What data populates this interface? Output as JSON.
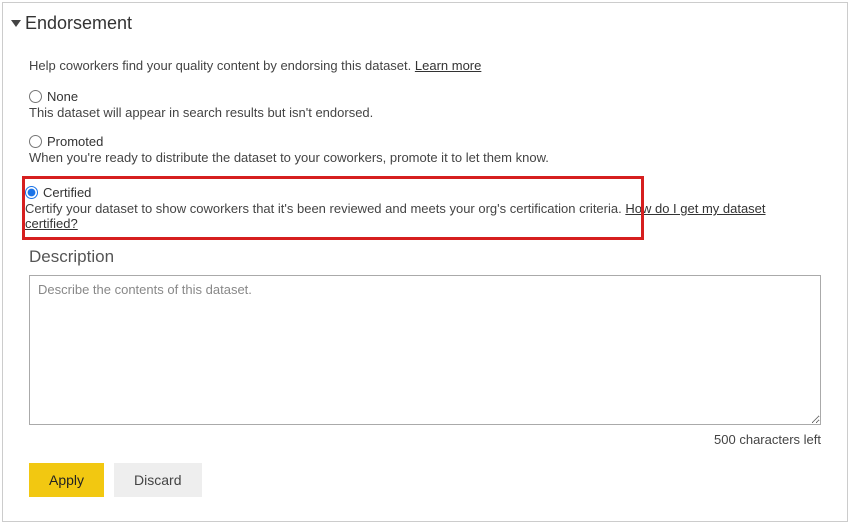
{
  "section": {
    "title": "Endorsement",
    "help_text": "Help coworkers find your quality content by endorsing this dataset. ",
    "learn_more": "Learn more"
  },
  "options": {
    "none": {
      "label": "None",
      "desc": "This dataset will appear in search results but isn't endorsed."
    },
    "promoted": {
      "label": "Promoted",
      "desc": "When you're ready to distribute the dataset to your coworkers, promote it to let them know."
    },
    "certified": {
      "label": "Certified",
      "desc": "Certify your dataset to show coworkers that it's been reviewed and meets your org's certification criteria. ",
      "link": "How do I get my dataset certified?"
    },
    "selected": "certified"
  },
  "description": {
    "title": "Description",
    "placeholder": "Describe the contents of this dataset.",
    "char_count": "500 characters left"
  },
  "buttons": {
    "apply": "Apply",
    "discard": "Discard"
  }
}
